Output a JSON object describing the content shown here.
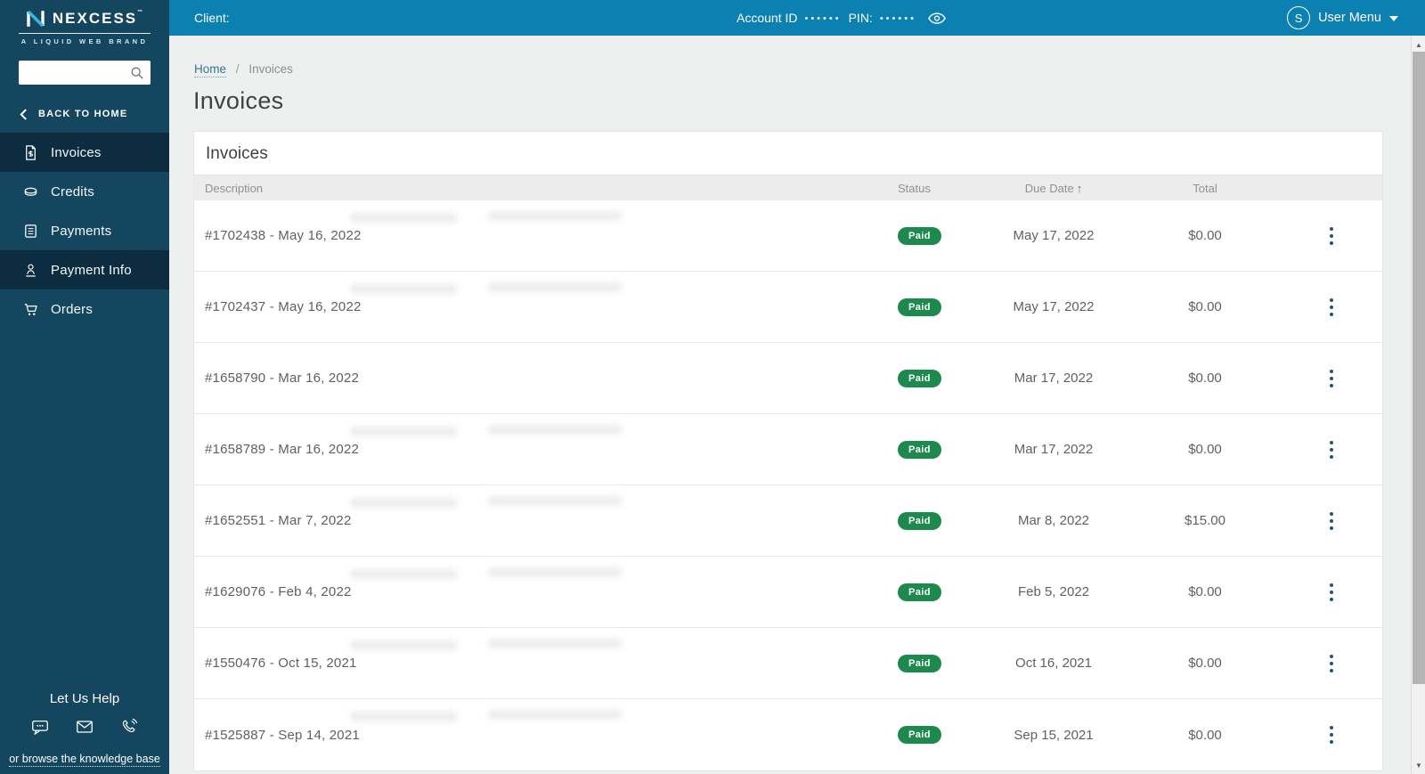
{
  "colors": {
    "topbar_teal": "#0d80b2",
    "sidebar_navy": "#15465f",
    "sidebar_active": "#0d2c40",
    "badge_green": "#1d8a4d",
    "breadcrumb_link": "#34758f"
  },
  "topbar": {
    "client_label": "Client:",
    "account_id_label": "Account ID",
    "account_id_mask": "••••••",
    "pin_label": "PIN:",
    "pin_mask": "••••••",
    "avatar_initial": "S",
    "user_menu_label": "User Menu"
  },
  "sidebar": {
    "logo": {
      "brand": "NEXCESS",
      "trademark": "™",
      "tagline": "A LIQUID WEB BRAND"
    },
    "search": {
      "value": "",
      "placeholder": ""
    },
    "back_link_label": "BACK TO HOME",
    "items": [
      {
        "label": "Invoices",
        "icon": "invoice-icon",
        "active": true
      },
      {
        "label": "Credits",
        "icon": "credits-icon",
        "active": false
      },
      {
        "label": "Payments",
        "icon": "payments-icon",
        "active": false
      },
      {
        "label": "Payment Info",
        "icon": "payment-info-icon",
        "active": true
      },
      {
        "label": "Orders",
        "icon": "orders-icon",
        "active": false
      }
    ],
    "help": {
      "title": "Let Us Help",
      "icons": [
        "chat-icon",
        "mail-icon",
        "phone-icon"
      ],
      "link_label": "or browse the knowledge base"
    }
  },
  "main": {
    "breadcrumb": {
      "home": "Home",
      "separator": "/",
      "current": "Invoices"
    },
    "page_title": "Invoices",
    "card": {
      "title": "Invoices",
      "columns": {
        "description": "Description",
        "status": "Status",
        "due_date": "Due Date",
        "total": "Total"
      },
      "sort": {
        "column": "Due Date",
        "direction": "ascending",
        "arrow": "↑"
      },
      "rows": [
        {
          "description": "#1702438 - May 16, 2022",
          "status": "Paid",
          "due_date": "May 17, 2022",
          "total": "$0.00",
          "redacted": true
        },
        {
          "description": "#1702437 - May 16, 2022",
          "status": "Paid",
          "due_date": "May 17, 2022",
          "total": "$0.00",
          "redacted": true
        },
        {
          "description": "#1658790 - Mar 16, 2022",
          "status": "Paid",
          "due_date": "Mar 17, 2022",
          "total": "$0.00",
          "redacted": false
        },
        {
          "description": "#1658789 - Mar 16, 2022",
          "status": "Paid",
          "due_date": "Mar 17, 2022",
          "total": "$0.00",
          "redacted": true
        },
        {
          "description": "#1652551 - Mar 7, 2022",
          "status": "Paid",
          "due_date": "Mar 8, 2022",
          "total": "$15.00",
          "redacted": true
        },
        {
          "description": "#1629076 - Feb 4, 2022",
          "status": "Paid",
          "due_date": "Feb 5, 2022",
          "total": "$0.00",
          "redacted": true
        },
        {
          "description": "#1550476 - Oct 15, 2021",
          "status": "Paid",
          "due_date": "Oct 16, 2021",
          "total": "$0.00",
          "redacted": true
        },
        {
          "description": "#1525887 - Sep 14, 2021",
          "status": "Paid",
          "due_date": "Sep 15, 2021",
          "total": "$0.00",
          "redacted": true
        }
      ]
    }
  }
}
